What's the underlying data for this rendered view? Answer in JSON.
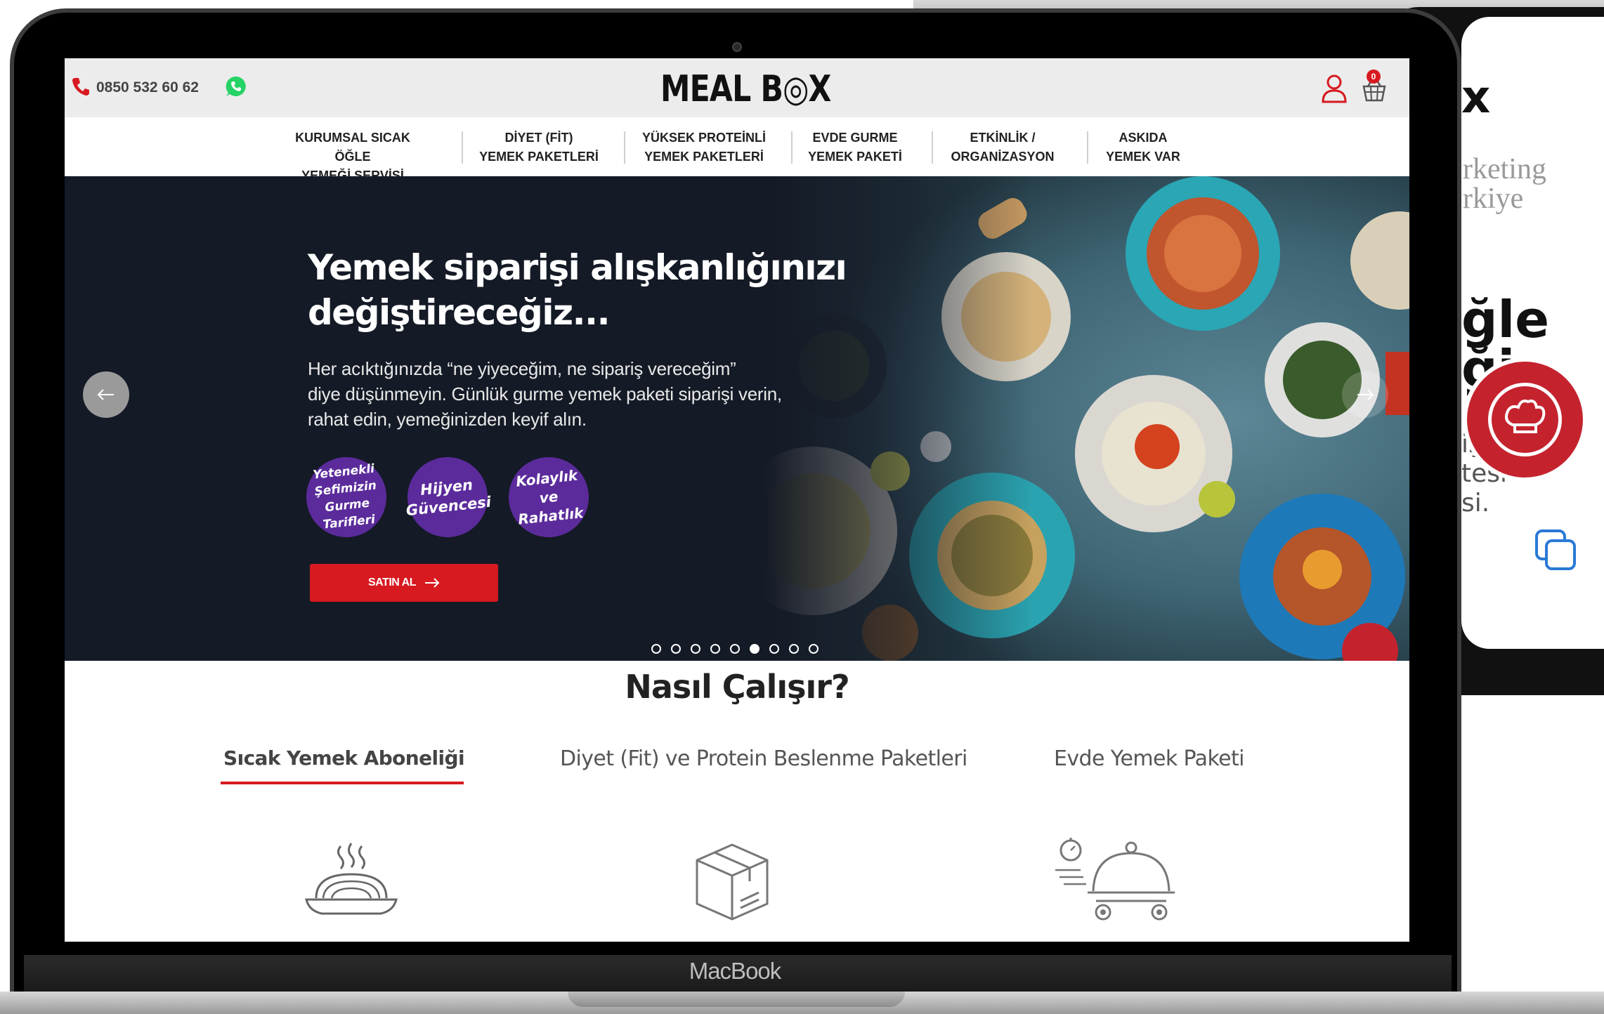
{
  "header": {
    "phone_number": "0850 532 60 62",
    "logo_text": "MEAL B◎X",
    "cart_count": "0"
  },
  "nav": {
    "items": [
      {
        "line1": "KURUMSAL SICAK ÖĞLE",
        "line2": "YEMEĞİ SERVİSİ"
      },
      {
        "line1": "DİYET (FİT)",
        "line2": "YEMEK PAKETLERİ"
      },
      {
        "line1": "YÜKSEK PROTEİNLİ",
        "line2": "YEMEK PAKETLERİ"
      },
      {
        "line1": "EVDE GURME",
        "line2": "YEMEK PAKETİ"
      },
      {
        "line1": "ETKİNLİK /",
        "line2": "ORGANİZASYON"
      },
      {
        "line1": "ASKIDA",
        "line2": "YEMEK VAR"
      }
    ]
  },
  "hero": {
    "title_line1": "Yemek siparişi alışkanlığınızı",
    "title_line2": "değiştireceğiz...",
    "desc_line1": "Her acıktığınızda “ne yiyeceğim, ne sipariş vereceğim”",
    "desc_line2": "diye düşünmeyin. Günlük gurme yemek paketi siparişi verin,",
    "desc_line3": "rahat edin, yemeğinizden keyif alın.",
    "badges": [
      {
        "l1": "Yetenekli",
        "l2": "Şefimizin",
        "l3": "Gurme",
        "l4": "Tarifleri"
      },
      {
        "l1": "Hijyen",
        "l2": "Güvencesi"
      },
      {
        "l1": "Kolaylık ve",
        "l2": "Rahatlık"
      }
    ],
    "buy_label": "SATIN AL",
    "slide_count": 9,
    "active_slide": 6
  },
  "how": {
    "title": "Nasıl Çalışır?",
    "tabs": [
      "Sıcak Yemek Aboneliği",
      "Diyet (Fit) ve Protein Beslenme Paketleri",
      "Evde Yemek Paketi"
    ],
    "active_tab": 0
  },
  "laptop": {
    "label": "MacBook"
  },
  "phone_bg": {
    "x_text": "x",
    "marketing_line1": "rketing",
    "marketing_line2": "rkiye",
    "big_line1": "ğle",
    "big_line2": "ği",
    "small_line1": "iş",
    "small_line2": "tesi",
    "small_line3": "si."
  },
  "colors": {
    "brand_red": "#d71920",
    "badge_purple": "#5b2b9b",
    "hero_dark": "#141a26",
    "whatsapp_green": "#25d366"
  }
}
